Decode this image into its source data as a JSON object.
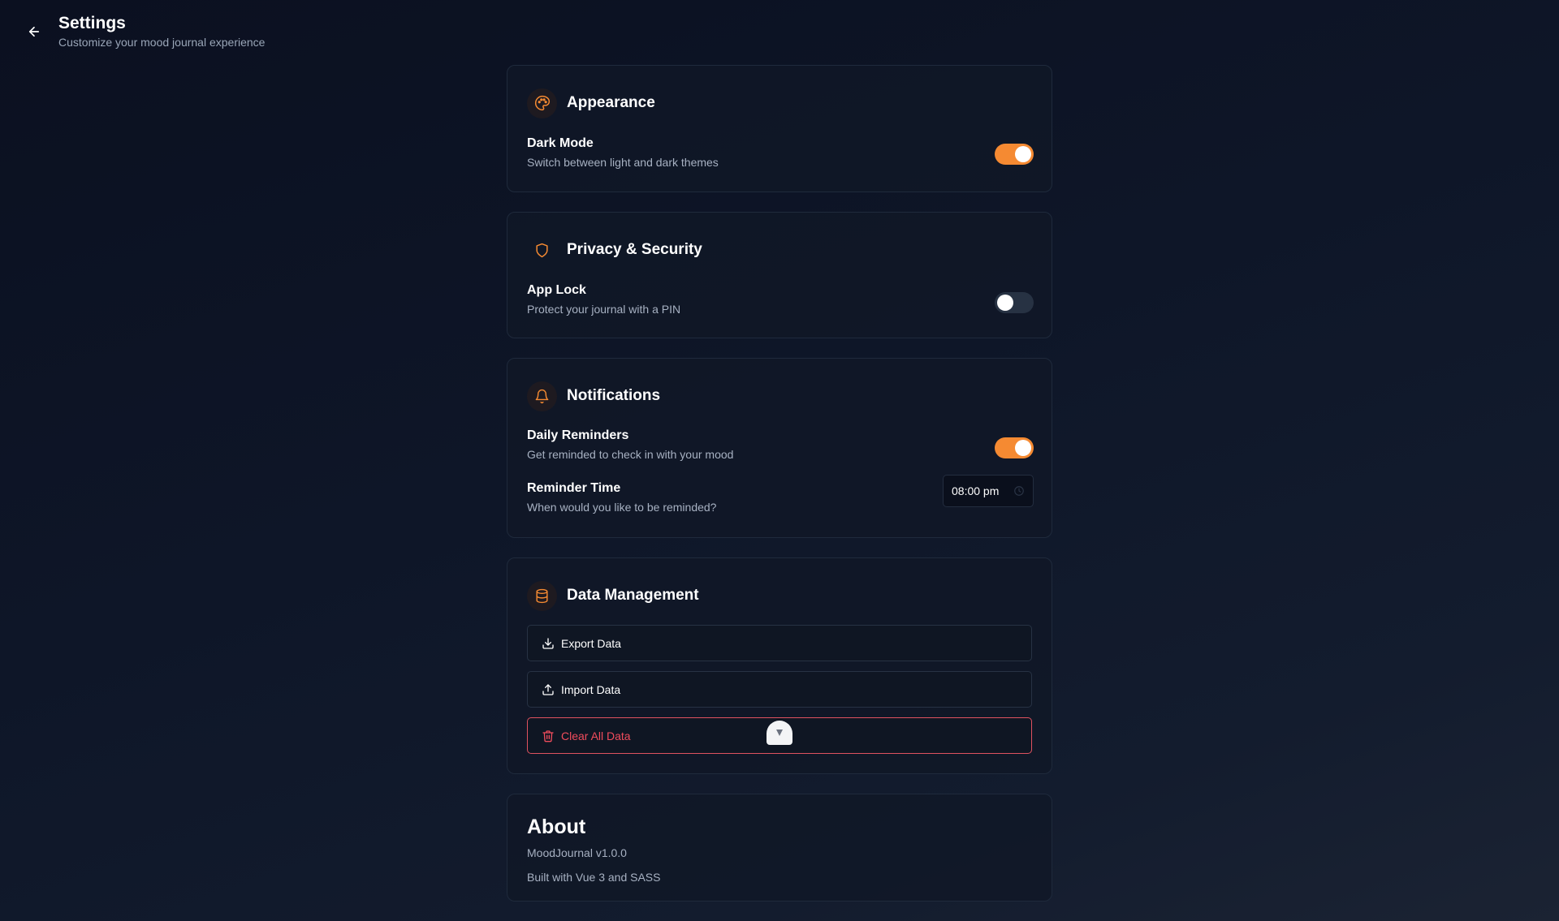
{
  "header": {
    "title": "Settings",
    "subtitle": "Customize your mood journal experience",
    "back_icon": "arrow-left-icon"
  },
  "appearance": {
    "title": "Appearance",
    "icon": "palette-icon",
    "dark_mode": {
      "label": "Dark Mode",
      "description": "Switch between light and dark themes",
      "enabled": true
    }
  },
  "privacy": {
    "title": "Privacy & Security",
    "icon": "shield-icon",
    "app_lock": {
      "label": "App Lock",
      "description": "Protect your journal with a PIN",
      "enabled": false
    }
  },
  "notifications": {
    "title": "Notifications",
    "icon": "bell-icon",
    "daily_reminders": {
      "label": "Daily Reminders",
      "description": "Get reminded to check in with your mood",
      "enabled": true
    },
    "reminder_time": {
      "label": "Reminder Time",
      "description": "When would you like to be reminded?",
      "value": "08:00 pm"
    }
  },
  "data_management": {
    "title": "Data Management",
    "icon": "database-icon",
    "export_label": "Export Data",
    "import_label": "Import Data",
    "clear_label": "Clear All Data"
  },
  "about": {
    "title": "About",
    "version": "MoodJournal v1.0.0",
    "built_with": "Built with Vue 3 and SASS"
  },
  "colors": {
    "accent": "#f58a32",
    "danger": "#f04c5c",
    "background": "#0e1628"
  }
}
